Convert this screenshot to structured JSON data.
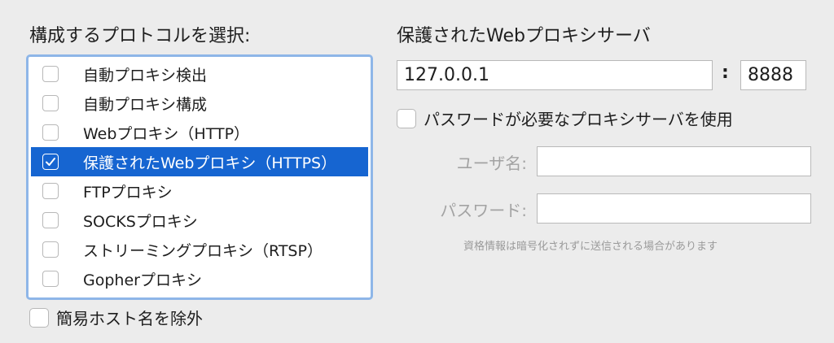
{
  "protocols": {
    "heading": "構成するプロトコルを選択:",
    "items": [
      {
        "label": "自動プロキシ検出",
        "checked": false,
        "selected": false
      },
      {
        "label": "自動プロキシ構成",
        "checked": false,
        "selected": false
      },
      {
        "label": "Webプロキシ（HTTP）",
        "checked": false,
        "selected": false
      },
      {
        "label": "保護されたWebプロキシ（HTTPS）",
        "checked": true,
        "selected": true
      },
      {
        "label": "FTPプロキシ",
        "checked": false,
        "selected": false
      },
      {
        "label": "SOCKSプロキシ",
        "checked": false,
        "selected": false
      },
      {
        "label": "ストリーミングプロキシ（RTSP）",
        "checked": false,
        "selected": false
      },
      {
        "label": "Gopherプロキシ",
        "checked": false,
        "selected": false
      }
    ]
  },
  "exclude_simple_hosts": {
    "label": "簡易ホスト名を除外",
    "checked": false
  },
  "server": {
    "heading": "保護されたWebプロキシサーバ",
    "host": "127.0.0.1",
    "port": "8888",
    "separator": ":"
  },
  "auth": {
    "label": "パスワードが必要なプロキシサーバを使用",
    "checked": false,
    "username_label": "ユーザ名:",
    "username": "",
    "password_label": "パスワード:",
    "password": "",
    "note": "資格情報は暗号化されずに送信される場合があります"
  },
  "colors": {
    "selection": "#1665d1",
    "focus_ring": "#8eb6e8",
    "window_bg": "#ececec"
  }
}
